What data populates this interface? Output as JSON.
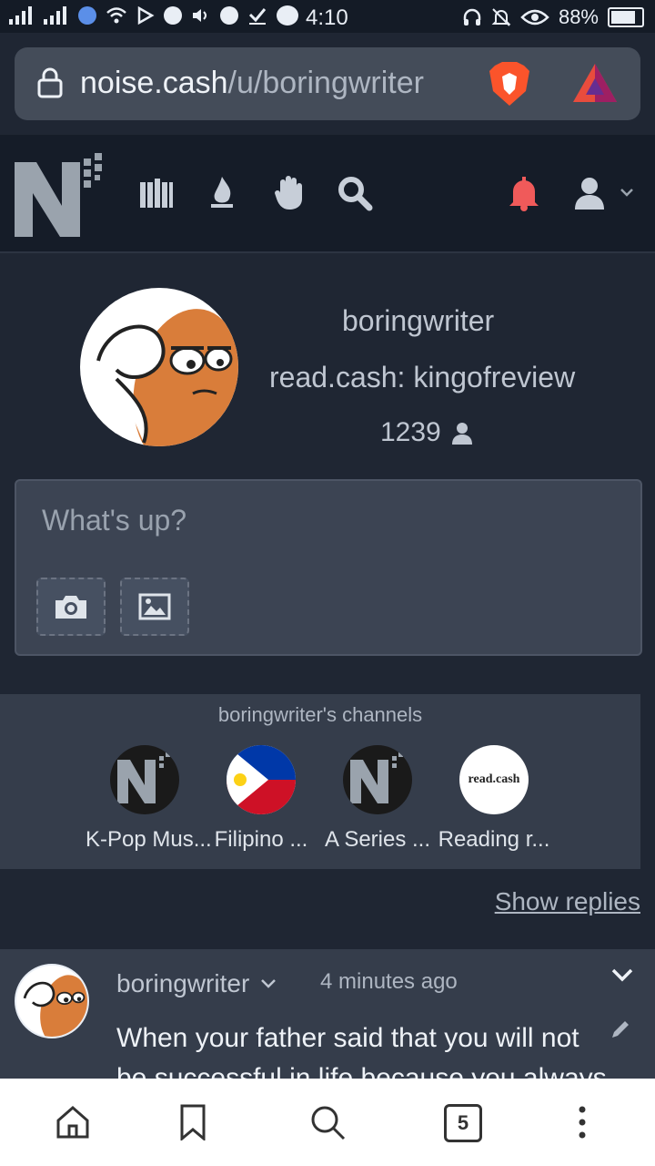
{
  "status": {
    "time": "4:10",
    "battery": "88%"
  },
  "browser": {
    "url_host": "noise.cash",
    "url_path": "/u/boringwriter"
  },
  "profile": {
    "username": "boringwriter",
    "readcash": "read.cash: kingofreview",
    "followers": "1239"
  },
  "composer": {
    "placeholder": "What's up?"
  },
  "channels": {
    "title": "boringwriter's channels",
    "items": [
      {
        "name": "K-Pop Mus..."
      },
      {
        "name": "Filipino ..."
      },
      {
        "name": "A Series ..."
      },
      {
        "name": "Reading r..."
      }
    ],
    "readcash_logo_text": "read.cash"
  },
  "show_replies": "Show replies",
  "post": {
    "author": "boringwriter",
    "time": "4 minutes ago",
    "text": "When your father said that you will not be successful in life because you always"
  },
  "bottom": {
    "tab_count": "5"
  },
  "colors": {
    "accent_bell": "#f05a5a",
    "bg": "#1f2633",
    "panel": "#353d4b"
  }
}
